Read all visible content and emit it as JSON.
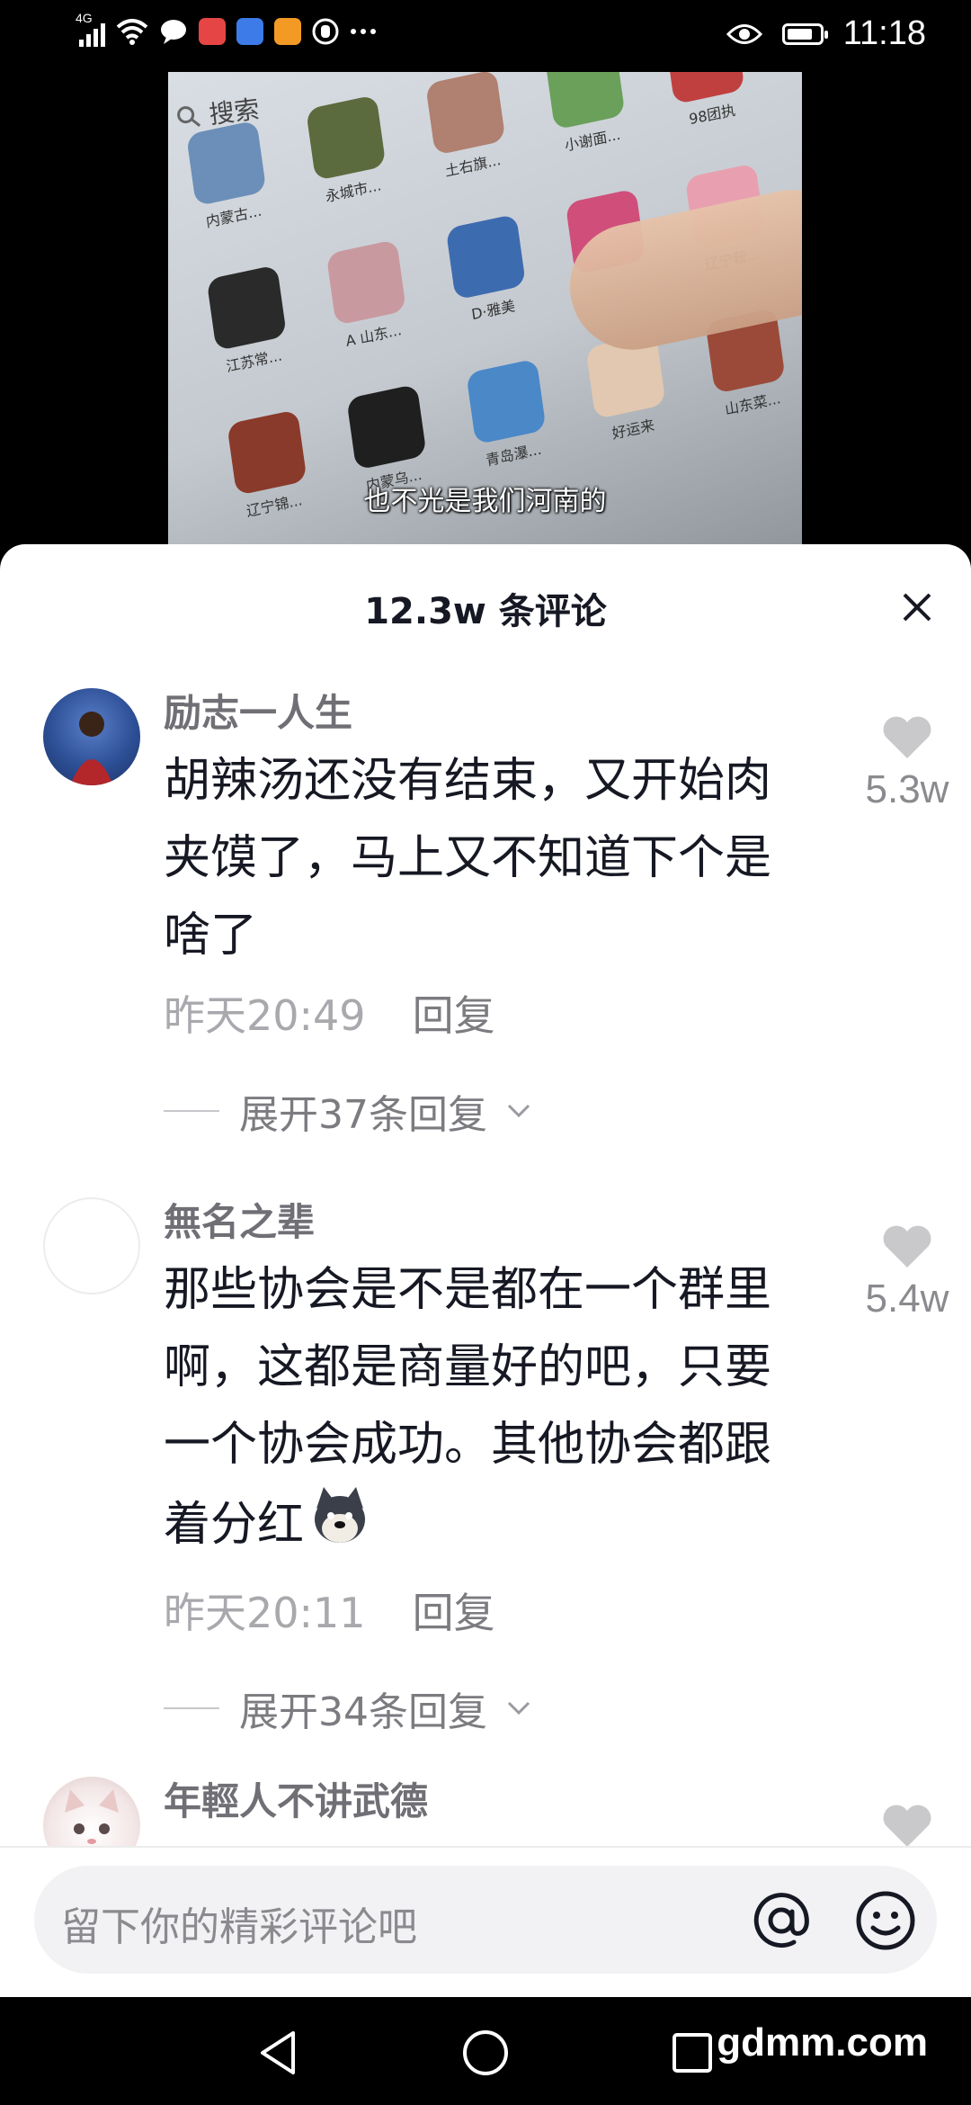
{
  "status_bar": {
    "network": "4G",
    "time": "11:18",
    "battery_level": 0.8,
    "notification_icons": [
      "signal-icon",
      "wifi-icon",
      "chat-bubble-icon",
      "huawei-app-icon",
      "music-app-icon",
      "video-app-icon",
      "gesture-icon",
      "more-dots-icon"
    ]
  },
  "video": {
    "search_label": "搜索",
    "apps": [
      "内蒙古...",
      "永城市...",
      "土右旗...",
      "小谢面...",
      "98团执",
      "江苏常...",
      "A 山东...",
      "D·雅美",
      "",
      "辽宁鞍...",
      "辽宁锦...",
      "内蒙乌...",
      "青岛瀑...",
      "好运来",
      "山东菜..."
    ],
    "caption": "也不光是我们河南的"
  },
  "sheet": {
    "comment_count_label": "12.3w 条评论",
    "comments": [
      {
        "username": "励志一人生",
        "text": "胡辣汤还没有结束，又开始肉夹馍了，马上又不知道下个是啥了",
        "time": "昨天20:49",
        "reply_label": "回复",
        "expand_label": "展开37条回复",
        "like_count": "5.3w"
      },
      {
        "username": "無名之辈",
        "text": "那些协会是不是都在一个群里啊，这都是商量好的吧，只要一个协会成功。其他协会都跟着分红",
        "emoji_icon": "doge-icon",
        "time": "昨天20:11",
        "reply_label": "回复",
        "expand_label": "展开34条回复",
        "like_count": "5.4w"
      },
      {
        "username": "年輕人不讲武德",
        "like_count": ""
      }
    ]
  },
  "input_bar": {
    "placeholder": "留下你的精彩评论吧"
  },
  "nav_bar": {
    "watermark": "gdmm.com"
  },
  "colors": {
    "sheet_bg": "#ffffff",
    "username": "#6f6f75",
    "meta": "#a8a8ad",
    "heart": "#c9c9cc"
  }
}
